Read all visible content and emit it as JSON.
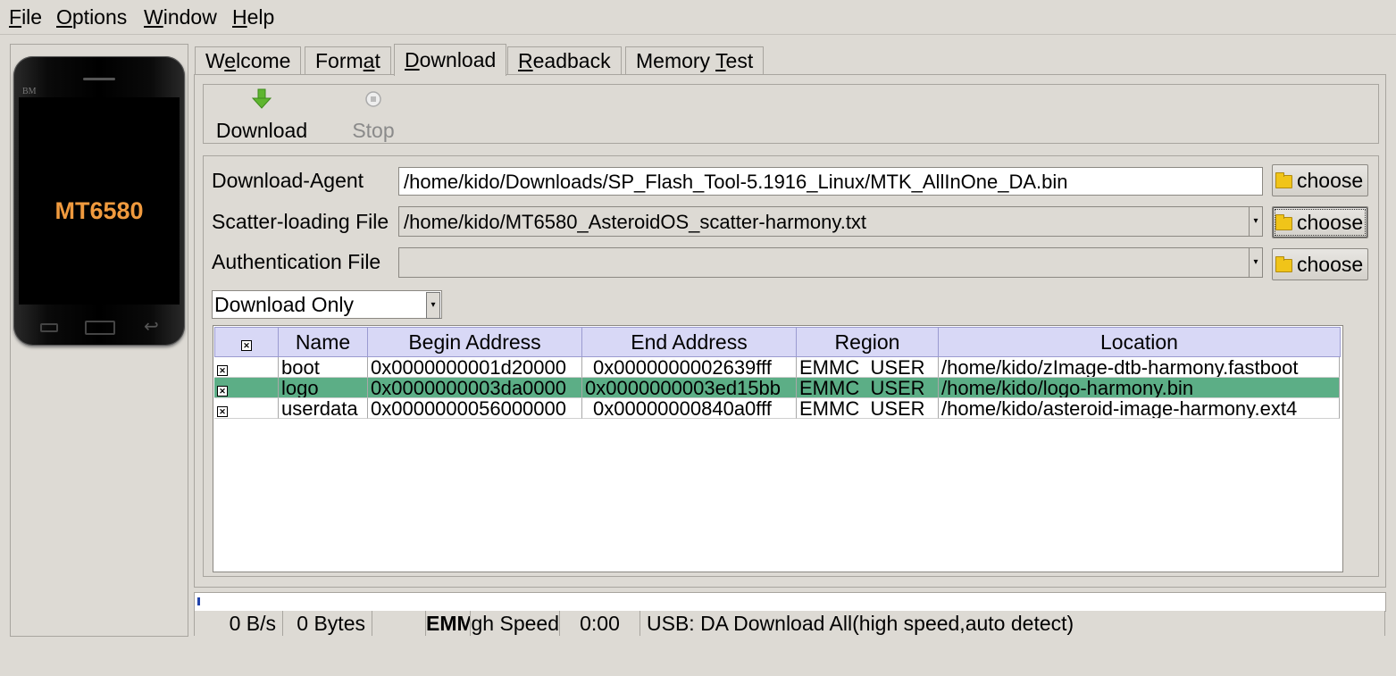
{
  "menu": [
    {
      "pre": "",
      "u": "F",
      "post": "ile"
    },
    {
      "pre": "",
      "u": "O",
      "post": "ptions"
    },
    {
      "pre": "",
      "u": "W",
      "post": "indow"
    },
    {
      "pre": "",
      "u": "H",
      "post": "elp"
    }
  ],
  "phone": {
    "brand": "BM",
    "model": "MT6580"
  },
  "tabs": [
    {
      "pre": "W",
      "u": "e",
      "post": "lcome"
    },
    {
      "pre": "Form",
      "u": "a",
      "post": "t"
    },
    {
      "pre": "",
      "u": "D",
      "post": "ownload"
    },
    {
      "pre": "",
      "u": "R",
      "post": "eadback"
    },
    {
      "pre": "Memory ",
      "u": "T",
      "post": "est"
    }
  ],
  "toolbar": {
    "download_label": "Download",
    "stop_label": "Stop"
  },
  "fields": {
    "download_agent": {
      "label": "Download-Agent",
      "value": "/home/kido/Downloads/SP_Flash_Tool-5.1916_Linux/MTK_AllInOne_DA.bin"
    },
    "scatter_file": {
      "label": "Scatter-loading File",
      "value": "/home/kido/MT6580_AsteroidOS_scatter-harmony.txt"
    },
    "auth_file": {
      "label": "Authentication File",
      "value": ""
    },
    "choose_label": "choose"
  },
  "mode_select": {
    "value": "Download Only"
  },
  "table": {
    "columns": [
      "Name",
      "Begin Address",
      "End Address",
      "Region",
      "Location"
    ],
    "rows": [
      {
        "checked": true,
        "name": "boot",
        "begin": "0x0000000001d20000",
        "end": "0x0000000002639fff",
        "region": "EMMC_USER",
        "location": "/home/kido/zImage-dtb-harmony.fastboot"
      },
      {
        "checked": true,
        "name": "logo",
        "begin": "0x0000000003da0000",
        "end": "0x0000000003ed15bb",
        "region": "EMMC_USER",
        "location": "/home/kido/logo-harmony.bin"
      },
      {
        "checked": true,
        "name": "userdata",
        "begin": "0x0000000056000000",
        "end": "0x00000000840a0fff",
        "region": "EMMC_USER",
        "location": "/home/kido/asteroid-image-harmony.ext4"
      }
    ]
  },
  "status": {
    "speed": "0 B/s",
    "bytes": "0 Bytes",
    "storage": "EMMC",
    "usb_speed": "High Speed",
    "time": "0:00",
    "message": "USB: DA Download All(high speed,auto detect)"
  },
  "progress": {
    "fraction": 0.0
  },
  "colors": {
    "selected_row": "#5cae86",
    "header_bg": "#d8d8f6",
    "phone_label": "#f09a3e",
    "download_icon": "#5fb52f"
  }
}
